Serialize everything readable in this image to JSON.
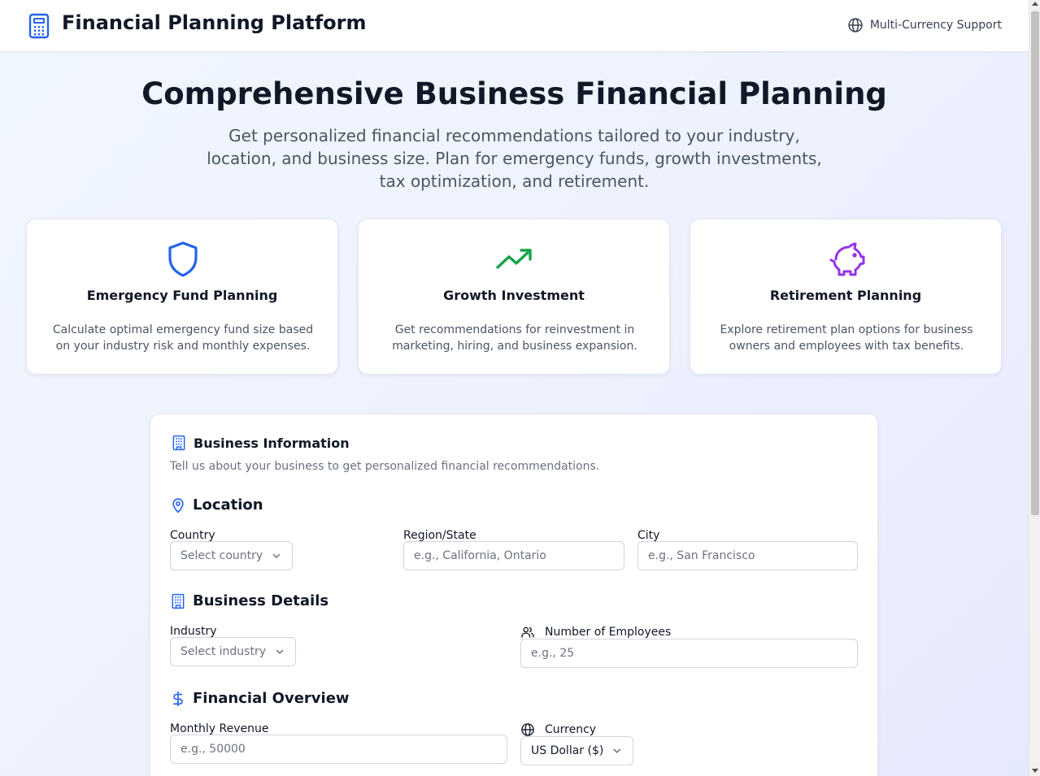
{
  "header": {
    "title": "Financial Planning Platform",
    "multi_currency_label": "Multi-Currency Support",
    "brand_color": "#2563eb"
  },
  "hero": {
    "title": "Comprehensive Business Financial Planning",
    "subtitle": "Get personalized financial recommendations tailored to your industry, location, and business size. Plan for emergency funds, growth investments, tax optimization, and retirement."
  },
  "features": [
    {
      "title": "Emergency Fund Planning",
      "description": "Calculate optimal emergency fund size based on your industry risk and monthly expenses.",
      "icon": "shield-icon",
      "color": "#2563eb"
    },
    {
      "title": "Growth Investment",
      "description": "Get recommendations for reinvestment in marketing, hiring, and business expansion.",
      "icon": "trending-up-icon",
      "color": "#16a34a"
    },
    {
      "title": "Retirement Planning",
      "description": "Explore retirement plan options for business owners and employees with tax benefits.",
      "icon": "piggy-bank-icon",
      "color": "#9333ea"
    }
  ],
  "form": {
    "title": "Business Information",
    "description": "Tell us about your business to get personalized financial recommendations.",
    "location": {
      "title": "Location",
      "country_label": "Country",
      "country_placeholder": "Select country",
      "region_label": "Region/State",
      "region_placeholder": "e.g., California, Ontario",
      "city_label": "City",
      "city_placeholder": "e.g., San Francisco"
    },
    "business_details": {
      "title": "Business Details",
      "industry_label": "Industry",
      "industry_placeholder": "Select industry",
      "employees_label": "Number of Employees",
      "employees_placeholder": "e.g., 25"
    },
    "financial_overview": {
      "title": "Financial Overview",
      "revenue_label": "Monthly Revenue",
      "revenue_placeholder": "e.g., 50000",
      "currency_label": "Currency",
      "currency_value": "US Dollar ($)"
    }
  }
}
